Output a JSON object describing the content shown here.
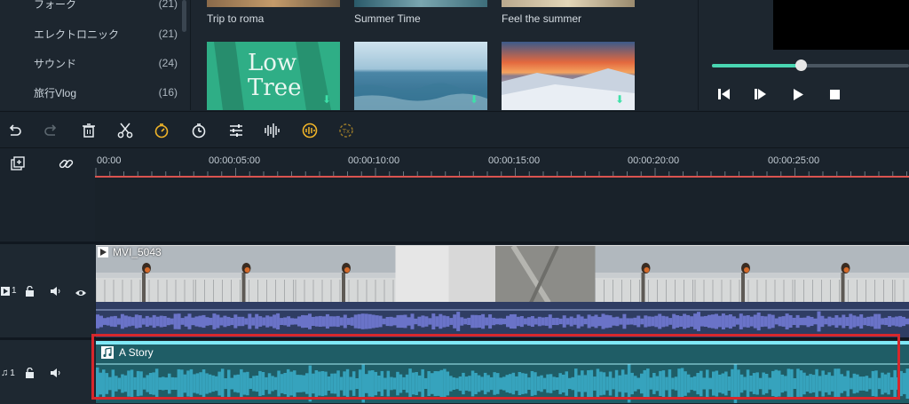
{
  "categories": [
    {
      "label": "フォーク",
      "count": "(21)"
    },
    {
      "label": "エレクトロニック",
      "count": "(21)"
    },
    {
      "label": "サウンド",
      "count": "(24)"
    },
    {
      "label": "旅行Vlog",
      "count": "(16)"
    }
  ],
  "media_items": [
    {
      "title": "Trip to roma"
    },
    {
      "title": "Summer Time"
    },
    {
      "title": "Feel the summer"
    },
    {
      "title": "Low Tree",
      "thumb_text": "Low Tree"
    },
    {
      "title": ""
    },
    {
      "title": ""
    }
  ],
  "player": {
    "progress": 0.45
  },
  "toolbar": {
    "icons": [
      "undo-icon",
      "redo-icon",
      "delete-icon",
      "cut-icon",
      "speed-icon",
      "duration-icon",
      "adjust-icon",
      "audio-mixer-icon",
      "voice-icon",
      "auto-reframe-icon"
    ]
  },
  "timeline": {
    "ticks": [
      "00:00",
      "00:00:05:00",
      "00:00:10:00",
      "00:00:15:00",
      "00:00:20:00",
      "00:00:25:00"
    ],
    "video_track": {
      "number": "1",
      "clip_name": "MVI_5043"
    },
    "audio_track": {
      "number": "1",
      "clip_name": "A Story"
    }
  },
  "colors": {
    "accent": "#49d6b2",
    "playhead": "#d9534f",
    "highlight": "#d7272c",
    "audio_clip": "#1f5d66",
    "audio_wave": "#36a3bd",
    "video_audio": "#2f3d63"
  }
}
